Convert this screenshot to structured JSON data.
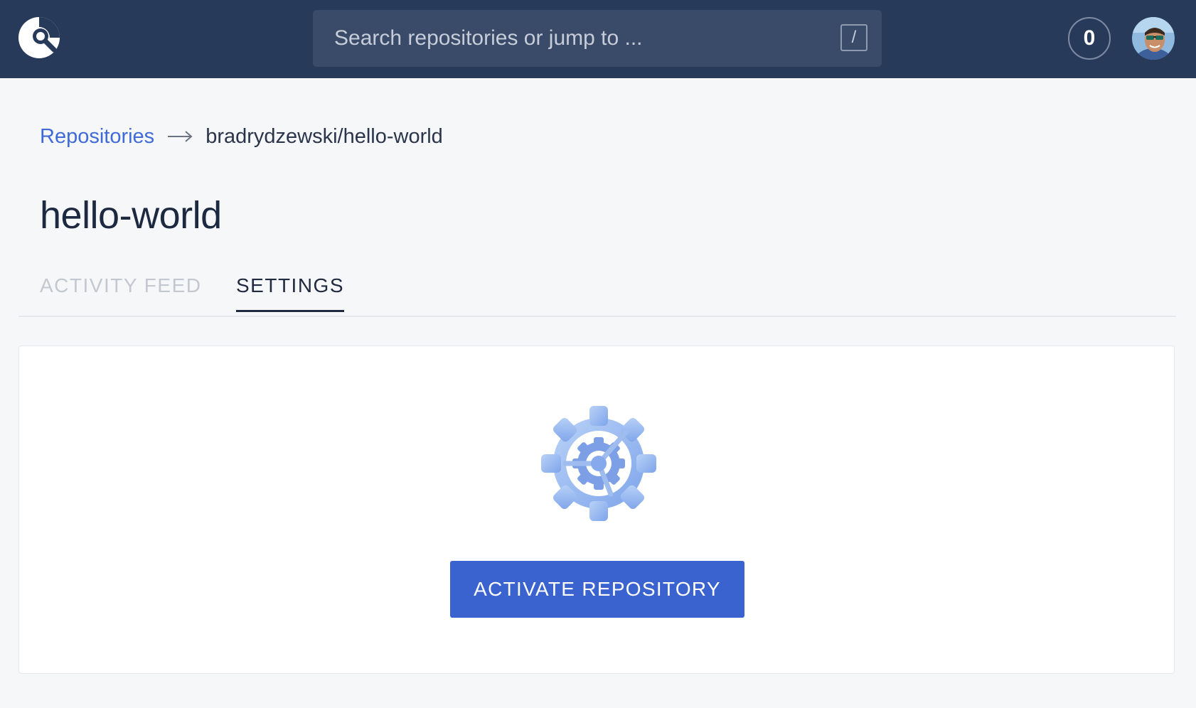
{
  "header": {
    "logo_icon": "drone-logo-icon",
    "search": {
      "placeholder": "Search repositories or jump to ...",
      "shortcut_key": "/"
    },
    "notifications_count": "0",
    "avatar_icon": "user-avatar"
  },
  "breadcrumb": {
    "root_label": "Repositories",
    "separator_icon": "arrow-right-icon",
    "current": "bradrydzewski/hello-world"
  },
  "page": {
    "title": "hello-world"
  },
  "tabs": [
    {
      "label": "ACTIVITY FEED",
      "active": false
    },
    {
      "label": "SETTINGS",
      "active": true
    }
  ],
  "main": {
    "illustration_icon": "gear-steering-icon",
    "activate_label": "ACTIVATE REPOSITORY"
  },
  "colors": {
    "header_bg": "#283a5a",
    "accent": "#3a63d0",
    "link": "#3f6ad8"
  }
}
